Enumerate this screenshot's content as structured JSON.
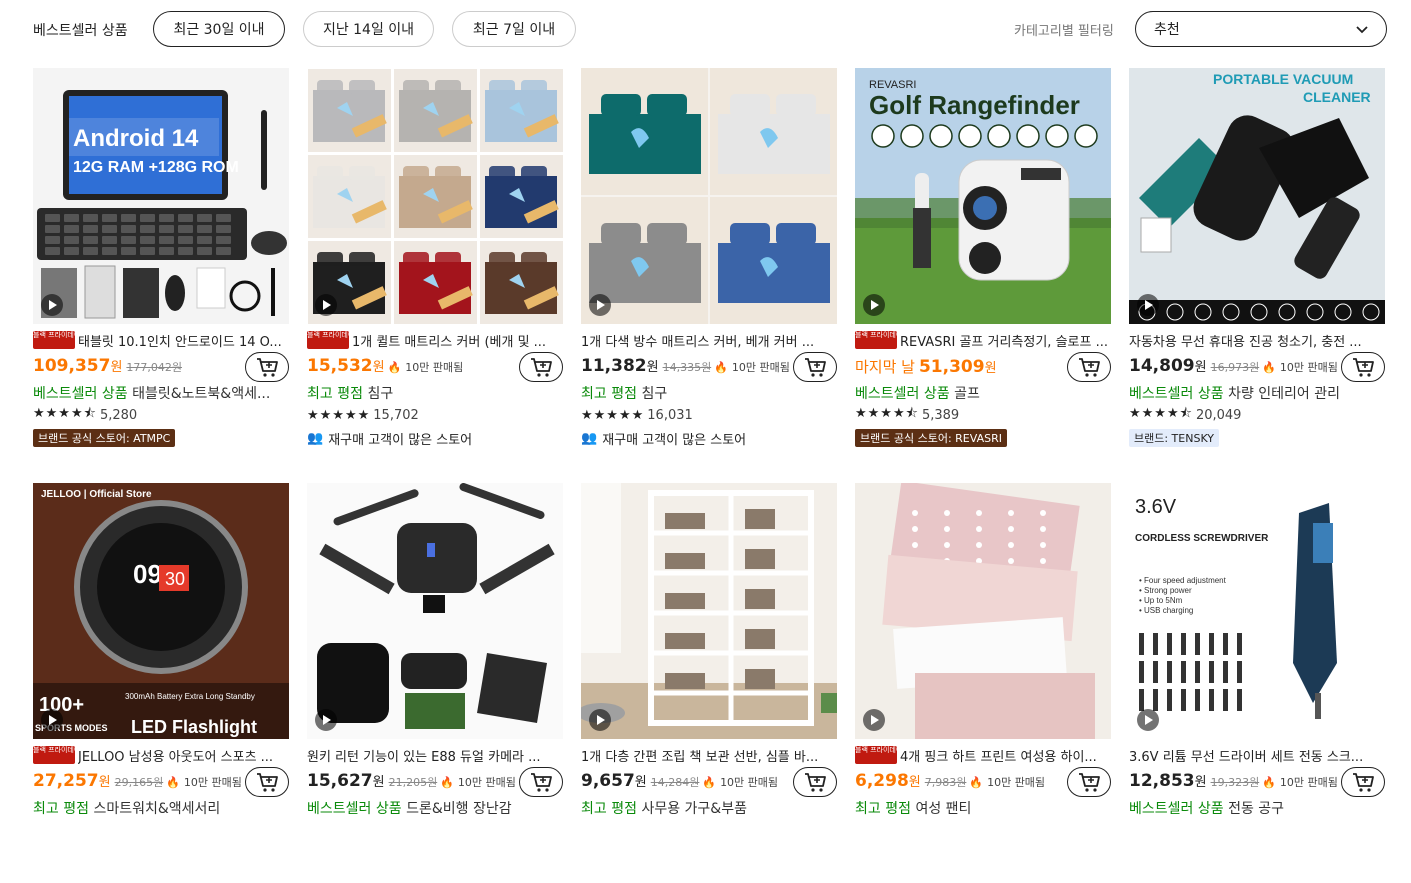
{
  "filters": {
    "section_label": "베스트셀러 상품",
    "chips": [
      "최근 30일 이내",
      "지난 14일 이내",
      "최근 7일 이내"
    ],
    "active_chip": 0,
    "category_filter_label": "카테고리별 필터링",
    "sort_value": "추천"
  },
  "products": [
    {
      "title": "태블릿 10.1인치 안드로이드 14 O...",
      "badge": "블랙 프라이데이",
      "price": "109,357",
      "won": "원",
      "orig": "177,042원",
      "sold": "",
      "price_orange": true,
      "tag_green": "베스트셀러 상품",
      "tag_rest": "태블릿&노트북&액세...",
      "stars": "★★★★⯪",
      "rating_count": "5,280",
      "store": "브랜드 공식 스토어: ATMPC",
      "store_type": "official",
      "image_text": "Android 14 · 12G RAM +128G ROM",
      "icon": "tablet"
    },
    {
      "title": "1개 퀼트 매트리스 커버 (베개 및 ...",
      "badge": "블랙 프라이데이",
      "price": "15,532",
      "won": "원",
      "orig": "",
      "sold": "10만 판매됨",
      "price_orange": true,
      "tag_green": "최고 평점",
      "tag_rest": "침구",
      "stars": "★★★★★",
      "rating_count": "15,702",
      "store": "재구매 고객이 많은 스토어",
      "store_type": "repurchase",
      "image_text": "waterproof",
      "icon": "mattress"
    },
    {
      "title": "1개 다색 방수 매트리스 커버, 베개 커버 ...",
      "badge": "",
      "price": "11,382",
      "won": "원",
      "orig": "14,335원",
      "sold": "10만 판매됨",
      "price_orange": false,
      "tag_green": "최고 평점",
      "tag_rest": "침구",
      "stars": "★★★★★",
      "rating_count": "16,031",
      "store": "재구매 고객이 많은 스토어",
      "store_type": "repurchase",
      "image_text": "",
      "icon": "bedcover"
    },
    {
      "title": "REVASRI 골프 거리측정기, 슬로프 ...",
      "badge": "블랙 프라이데이",
      "price": "51,309",
      "won": "원",
      "orig": "",
      "sold": "",
      "last_day": "마지막 날",
      "price_orange": true,
      "tag_green": "베스트셀러 상품",
      "tag_rest": "골프",
      "stars": "★★★★⯪",
      "rating_count": "5,389",
      "store": "브랜드 공식 스토어: REVASRI",
      "store_type": "official",
      "image_text": "REVASRI · Golf Rangefinder",
      "icon": "rangefinder"
    },
    {
      "title": "자동차용 무선 휴대용 진공 청소기, 충전 ...",
      "badge": "",
      "price": "14,809",
      "won": "원",
      "orig": "16,973원",
      "sold": "10만 판매됨",
      "price_orange": false,
      "tag_green": "베스트셀러 상품",
      "tag_rest": "차량 인테리어 관리",
      "stars": "★★★★⯪",
      "rating_count": "20,049",
      "store": "브랜드: TENSKY",
      "store_type": "plain",
      "image_text": "PORTABLE VACUUM CLEANER",
      "icon": "vacuum"
    },
    {
      "title": "JELLOO 남성용 아웃도어 스포츠 ...",
      "badge": "블랙 프라이데이",
      "price": "27,257",
      "won": "원",
      "orig": "29,165원",
      "sold": "10만 판매됨",
      "price_orange": true,
      "tag_green": "최고 평점",
      "tag_rest": "스마트워치&액세서리",
      "stars": "",
      "rating_count": "",
      "store": "",
      "store_type": "",
      "image_text": "JELLOO Official Store · 100+ SPORTS MODES · LED Flashlight · 300mAh Battery Extra Long Standby",
      "icon": "watch"
    },
    {
      "title": "원키 리턴 기능이 있는 E88 듀얼 카메라 ...",
      "badge": "",
      "price": "15,627",
      "won": "원",
      "orig": "21,205원",
      "sold": "10만 판매됨",
      "price_orange": false,
      "tag_green": "베스트셀러 상품",
      "tag_rest": "드론&비행 장난감",
      "stars": "",
      "rating_count": "",
      "store": "",
      "store_type": "",
      "image_text": "",
      "icon": "drone"
    },
    {
      "title": "1개 다층 간편 조립 책 보관 선반, 심플 바...",
      "badge": "",
      "price": "9,657",
      "won": "원",
      "orig": "14,284원",
      "sold": "10만 판매됨",
      "price_orange": false,
      "tag_green": "최고 평점",
      "tag_rest": "사무용 가구&부품",
      "stars": "",
      "rating_count": "",
      "store": "",
      "store_type": "",
      "image_text": "",
      "icon": "shelf"
    },
    {
      "title": "4개 핑크 하트 프린트 여성용 하이...",
      "badge": "블랙 프라이데이",
      "price": "6,298",
      "won": "원",
      "orig": "7,983원",
      "sold": "10만 판매됨",
      "price_orange": true,
      "tag_green": "최고 평점",
      "tag_rest": "여성 팬티",
      "stars": "",
      "rating_count": "",
      "store": "",
      "store_type": "",
      "image_text": "",
      "icon": "underwear"
    },
    {
      "title": "3.6V 리튬 무선 드라이버 세트 전동 스크...",
      "badge": "",
      "price": "12,853",
      "won": "원",
      "orig": "19,323원",
      "sold": "10만 판매됨",
      "price_orange": false,
      "tag_green": "베스트셀러 상품",
      "tag_rest": "전동 공구",
      "stars": "",
      "rating_count": "",
      "store": "",
      "store_type": "",
      "image_text": "3.6V · CORDLESS SCREWDRIVER · Four speed adjustment · Strong power · Up to 5Nm · USB charging",
      "icon": "screwdriver"
    }
  ],
  "colors": {
    "accent": "#fb7701",
    "green": "#0a8a0a",
    "badge_red": "#c01a10",
    "brand_brown": "#5c2f14"
  }
}
